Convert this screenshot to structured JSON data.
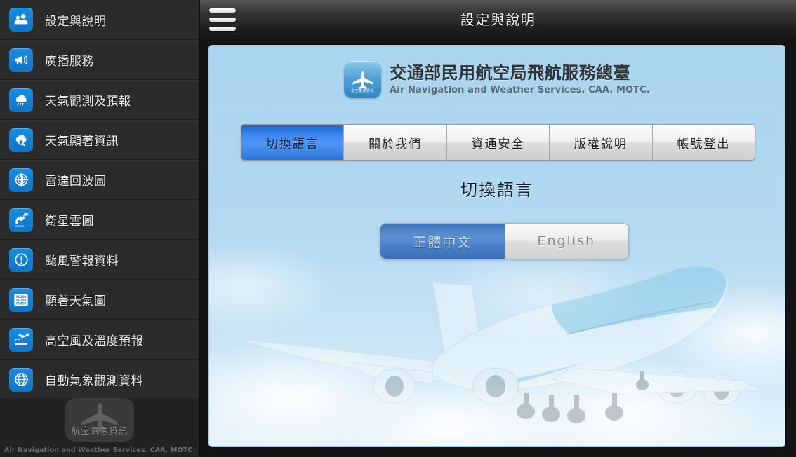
{
  "header": {
    "title": "設定與說明",
    "menu_icon": "hamburger-menu-icon"
  },
  "sidebar": {
    "items": [
      {
        "label": "設定與說明",
        "icon": "people-settings-icon"
      },
      {
        "label": "廣播服務",
        "icon": "megaphone-broadcast-icon"
      },
      {
        "label": "天氣觀測及預報",
        "icon": "cloud-rain-icon"
      },
      {
        "label": "天氣顯著資訊",
        "icon": "cloud-search-icon"
      },
      {
        "label": "雷達回波圖",
        "icon": "radar-globe-icon"
      },
      {
        "label": "衛星雲圖",
        "icon": "satellite-dish-icon"
      },
      {
        "label": "颱風警報資料",
        "icon": "exclamation-circle-icon"
      },
      {
        "label": "顯著天氣圖",
        "icon": "flight-level-chart-icon"
      },
      {
        "label": "高空風及溫度預報",
        "icon": "airplane-takeoff-icon"
      },
      {
        "label": "自動氣象觀測資料",
        "icon": "globe-grid-icon"
      }
    ],
    "footer": {
      "badge_label": "航空氣象資訊",
      "badge_icon": "app-logo-icon",
      "subtitle": "Air Navigation and Weather Services. CAA. MOTC."
    }
  },
  "panel": {
    "branding": {
      "logo_icon": "airplane-logo-icon",
      "logo_mini_text": "航空氣象資訊",
      "org_zh": "交通部民用航空局飛航服務總臺",
      "org_en": "Air Navigation and Weather Services. CAA. MOTC."
    },
    "tabs": [
      {
        "label": "切換語言",
        "selected": true
      },
      {
        "label": "關於我們",
        "selected": false
      },
      {
        "label": "資通安全",
        "selected": false
      },
      {
        "label": "版權說明",
        "selected": false
      },
      {
        "label": "帳號登出",
        "selected": false
      }
    ],
    "section_title": "切換語言",
    "language_toggle": {
      "options": [
        {
          "label": "正體中文",
          "selected": true
        },
        {
          "label": "English",
          "selected": false
        }
      ]
    },
    "background_image": "airplane-landing-photo"
  },
  "colors": {
    "accent_blue": "#1683d8",
    "panel_sky": "#a9d4ef",
    "tab_selected": "#3d86ec",
    "sidebar_bg": "#2b2b2b",
    "topbar_dark": "#202020"
  }
}
